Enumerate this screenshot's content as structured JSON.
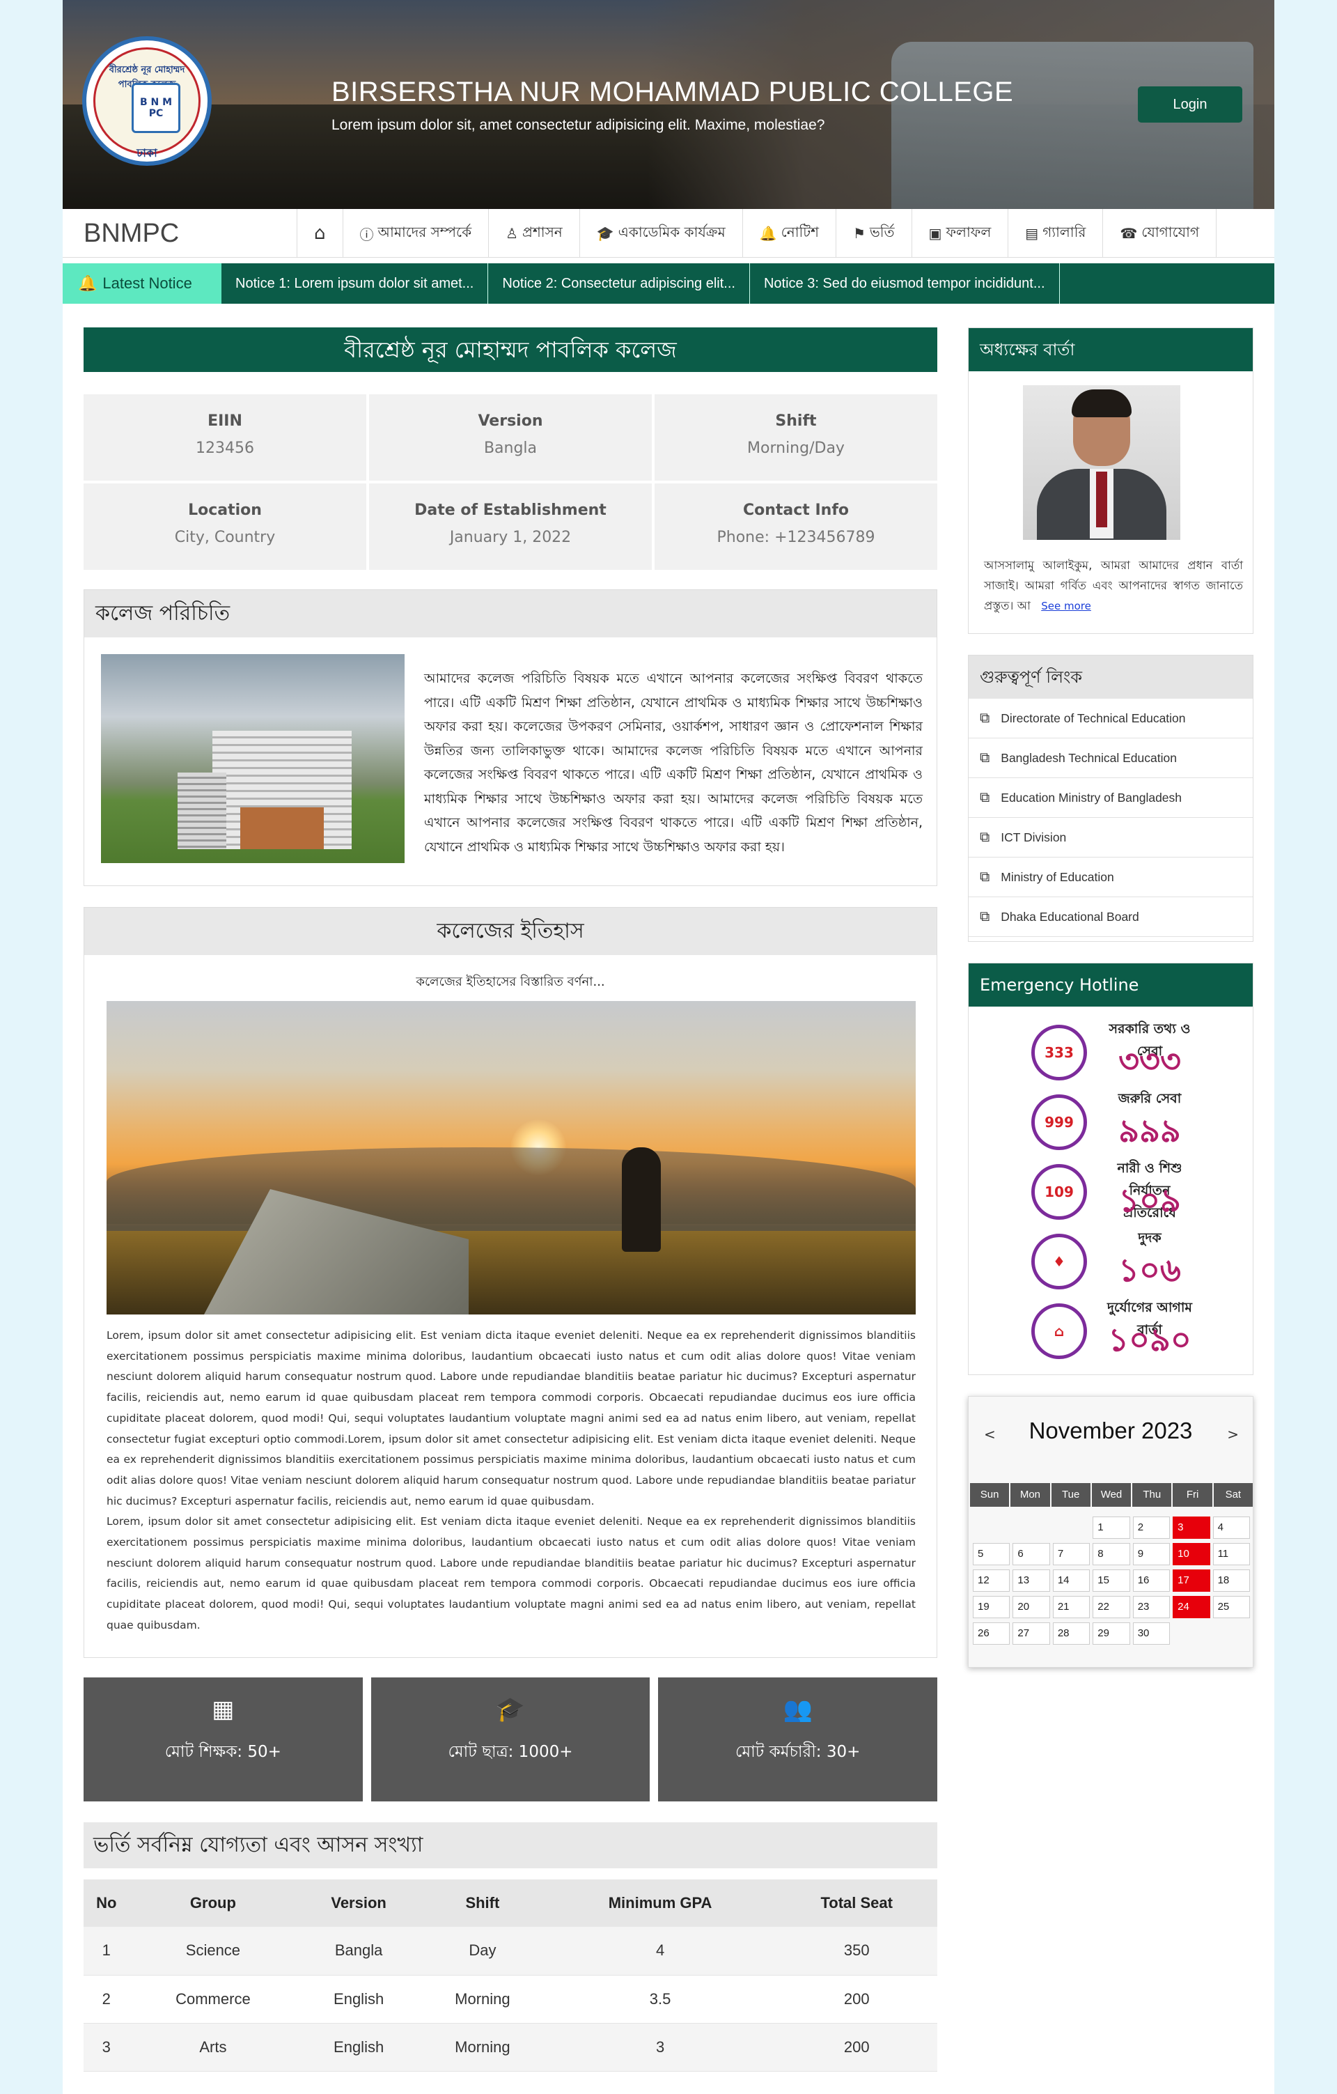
{
  "header": {
    "title": "BIRSERSTHA NUR MOHAMMAD PUBLIC COLLEGE",
    "subtitle": "Lorem ipsum dolor sit, amet consectetur adipisicing elit. Maxime, molestiae?",
    "login_label": "Login",
    "logo_caption": "বীরশ্রেষ্ঠ নূর মোহাম্মদ পাবলিক কলেজ",
    "logo_letters": "B N M PC",
    "logo_city": "ঢাকা"
  },
  "nav": {
    "brand": "BNMPC",
    "items": [
      {
        "label": "",
        "icon": "home-icon"
      },
      {
        "label": "আমাদের সম্পর্কে",
        "icon": "info-icon"
      },
      {
        "label": "প্রশাসন",
        "icon": "user-icon"
      },
      {
        "label": "একাডেমিক কার্যক্রম",
        "icon": "graduation-cap-icon"
      },
      {
        "label": "নোটিশ",
        "icon": "bell-icon"
      },
      {
        "label": "ভর্তি",
        "icon": "admission-icon"
      },
      {
        "label": "ফলাফল",
        "icon": "result-icon"
      },
      {
        "label": "গ্যালারি",
        "icon": "gallery-icon"
      },
      {
        "label": "যোগাযোগ",
        "icon": "contact-icon"
      }
    ]
  },
  "notice": {
    "label": "Latest Notice",
    "items": [
      "Notice 1: Lorem ipsum dolor sit amet...",
      "Notice 2: Consectetur adipiscing elit...",
      "Notice 3: Sed do eiusmod tempor incididunt..."
    ]
  },
  "main": {
    "college_name": "বীরশ্রেষ্ঠ নূর মোহাম্মদ পাবলিক কলেজ",
    "info": [
      {
        "key": "EIIN",
        "value": "123456"
      },
      {
        "key": "Version",
        "value": "Bangla"
      },
      {
        "key": "Shift",
        "value": "Morning/Day"
      },
      {
        "key": "Location",
        "value": "City, Country"
      },
      {
        "key": "Date of Establishment",
        "value": "January 1, 2022"
      },
      {
        "key": "Contact Info",
        "value": "Phone: +123456789"
      }
    ],
    "intro": {
      "heading": "কলেজ পরিচিতি",
      "text": "আমাদের কলেজ পরিচিতি বিষয়ক মতে এখানে আপনার কলেজের সংক্ষিপ্ত বিবরণ থাকতে পারে। এটি একটি মিশ্রণ শিক্ষা প্রতিষ্ঠান, যেখানে প্রাথমিক ও মাধ্যমিক শিক্ষার সাথে উচ্চশিক্ষাও অফার করা হয়। কলেজের উপকরণ সেমিনার, ওয়ার্কশপ, সাধারণ জ্ঞান ও প্রোফেশনাল শিক্ষার উন্নতির জন্য তালিকাভুক্ত থাকে। আমাদের কলেজ পরিচিতি বিষয়ক মতে এখানে আপনার কলেজের সংক্ষিপ্ত বিবরণ থাকতে পারে। এটি একটি মিশ্রণ শিক্ষা প্রতিষ্ঠান, যেখানে প্রাথমিক ও মাধ্যমিক শিক্ষার সাথে উচ্চশিক্ষাও অফার করা হয়। আমাদের কলেজ পরিচিতি বিষয়ক মতে এখানে আপনার কলেজের সংক্ষিপ্ত বিবরণ থাকতে পারে। এটি একটি মিশ্রণ শিক্ষা প্রতিষ্ঠান, যেখানে প্রাথমিক ও মাধ্যমিক শিক্ষার সাথে উচ্চশিক্ষাও অফার করা হয়।"
    },
    "history": {
      "heading": "কলেজের ইতিহাস",
      "subheading": "কলেজের ইতিহাসের বিস্তারিত বর্ণনা...",
      "paragraph1": "Lorem, ipsum dolor sit amet consectetur adipisicing elit. Est veniam dicta itaque eveniet deleniti. Neque ea ex reprehenderit dignissimos blanditiis exercitationem possimus perspiciatis maxime minima doloribus, laudantium obcaecati iusto natus et cum odit alias dolore quos! Vitae veniam nesciunt dolorem aliquid harum consequatur nostrum quod. Labore unde repudiandae blanditiis beatae pariatur hic ducimus? Excepturi aspernatur facilis, reiciendis aut, nemo earum id quae quibusdam placeat rem tempora commodi corporis. Obcaecati repudiandae ducimus eos iure officia cupiditate placeat dolorem, quod modi! Qui, sequi voluptates laudantium voluptate magni animi sed ea ad natus enim libero, aut veniam, repellat consectetur fugiat excepturi optio commodi.Lorem, ipsum dolor sit amet consectetur adipisicing elit. Est veniam dicta itaque eveniet deleniti. Neque ea ex reprehenderit dignissimos blanditiis exercitationem possimus perspiciatis maxime minima doloribus, laudantium obcaecati iusto natus et cum odit alias dolore quos! Vitae veniam nesciunt dolorem aliquid harum consequatur nostrum quod. Labore unde repudiandae blanditiis beatae pariatur hic ducimus? Excepturi aspernatur facilis, reiciendis aut, nemo earum id quae quibusdam.",
      "paragraph2": "Lorem, ipsum dolor sit amet consectetur adipisicing elit. Est veniam dicta itaque eveniet deleniti. Neque ea ex reprehenderit dignissimos blanditiis exercitationem possimus perspiciatis maxime minima doloribus, laudantium obcaecati iusto natus et cum odit alias dolore quos! Vitae veniam nesciunt dolorem aliquid harum consequatur nostrum quod. Labore unde repudiandae blanditiis beatae pariatur hic ducimus? Excepturi aspernatur facilis, reiciendis aut, nemo earum id quae quibusdam placeat rem tempora commodi corporis. Obcaecati repudiandae ducimus eos iure officia cupiditate placeat dolorem, quod modi! Qui, sequi voluptates laudantium voluptate magni animi sed ea ad natus enim libero, aut veniam, repellat quae quibusdam."
    },
    "stats": [
      {
        "icon": "teacher-icon",
        "label": "মোট শিক্ষক: 50+"
      },
      {
        "icon": "student-icon",
        "label": "মোট ছাত্র: 1000+"
      },
      {
        "icon": "staff-icon",
        "label": "মোট কর্মচারী: 30+"
      }
    ],
    "admission": {
      "heading": "ভর্তি সর্বনিম্ন যোগ্যতা এবং আসন সংখ্যা",
      "columns": [
        "No",
        "Group",
        "Version",
        "Shift",
        "Minimum GPA",
        "Total Seat"
      ],
      "rows": [
        [
          "1",
          "Science",
          "Bangla",
          "Day",
          "4",
          "350"
        ],
        [
          "2",
          "Commerce",
          "English",
          "Morning",
          "3.5",
          "200"
        ],
        [
          "3",
          "Arts",
          "English",
          "Morning",
          "3",
          "200"
        ]
      ]
    }
  },
  "sidebar": {
    "principal": {
      "heading": "অধ্যক্ষের বার্তা",
      "text": "আসসালামু আলাইকুম, আমরা আমাদের প্রধান বার্তা সাজাই। আমরা গর্বিত এবং আপনাদের স্বাগত জানাতে প্রস্তুত। আ",
      "see_more": "See more"
    },
    "links": {
      "heading": "গুরুত্বপূর্ণ লিংক",
      "items": [
        "Directorate of Technical Education",
        "Bangladesh Technical Education",
        "Education Ministry of Bangladesh",
        "ICT Division",
        "Ministry of Education",
        "Dhaka Educational Board"
      ]
    },
    "hotline": {
      "heading": "Emergency Hotline",
      "items": [
        {
          "label": "সরকারি তথ্য ও সেবা",
          "number": "৩৩৩",
          "badge": "333"
        },
        {
          "label": "জরুরি সেবা",
          "number": "৯৯৯",
          "badge": "999"
        },
        {
          "label": "নারী ও শিশু নির্যাতন প্রতিরোধে",
          "number": "১০৯",
          "badge": "109"
        },
        {
          "label": "দুদক",
          "number": "১০৬",
          "badge": "♦"
        },
        {
          "label": "দুর্যোগের আগাম বার্তা",
          "number": "১০৯০",
          "badge": "⌂"
        }
      ]
    },
    "calendar": {
      "month_label": "November 2023",
      "prev": "<",
      "next": ">",
      "weekdays": [
        "Sun",
        "Mon",
        "Tue",
        "Wed",
        "Thu",
        "Fri",
        "Sat"
      ],
      "leading_blanks": 3,
      "days": 30,
      "highlighted": [
        3,
        10,
        17,
        24
      ]
    }
  }
}
